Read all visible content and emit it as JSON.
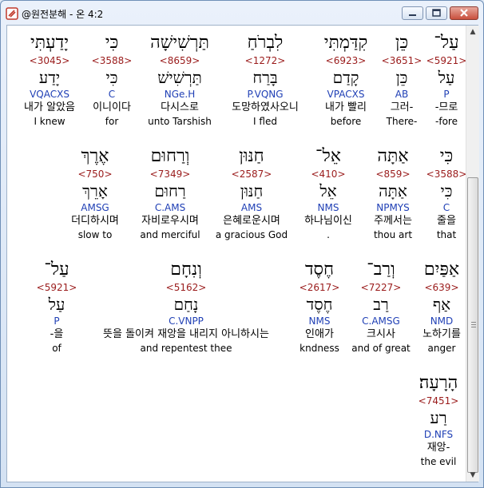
{
  "window": {
    "title": "@원전분해 - 온 4:2",
    "icon": "app-dictionary-icon"
  },
  "words": [
    {
      "heb": "עַל־",
      "strong": "<5921>",
      "lemma": "עַל",
      "morph": "P",
      "kor": "-므로",
      "eng": "-fore"
    },
    {
      "heb": "כֵּן",
      "strong": "<3651>",
      "lemma": "כֵּן",
      "morph": "AB",
      "kor": "그러-",
      "eng": "There-"
    },
    {
      "heb": "קִדַּמְתִּי",
      "strong": "<6923>",
      "lemma": "קָדַם",
      "morph": "VPACXS",
      "kor": "내가 빨리",
      "eng": "before"
    },
    {
      "heb": "לִבְרֹחַ",
      "strong": "<1272>",
      "lemma": "בָּרַח",
      "morph": "P.VQNG",
      "kor": "도망하였사오니",
      "eng": "I fled"
    },
    {
      "heb": "תַּרְשִׁישָׁה",
      "strong": "<8659>",
      "lemma": "תַּרְשִׁישׁ",
      "morph": "NGe.H",
      "kor": "다시스로",
      "eng": "unto Tarshish"
    },
    {
      "heb": "כִּי",
      "strong": "<3588>",
      "lemma": "כִּי",
      "morph": "C",
      "kor": "이니이다",
      "eng": "for"
    },
    {
      "heb": "יָדַעְתִּי",
      "strong": "<3045>",
      "lemma": "יָדַע",
      "morph": "VQACXS",
      "kor": "내가 알았음",
      "eng": "I knew"
    },
    {
      "heb": "כִּי",
      "strong": "<3588>",
      "lemma": "כִּי",
      "morph": "C",
      "kor": "줄을",
      "eng": "that"
    },
    {
      "heb": "אַתָּה",
      "strong": "<859>",
      "lemma": "אַתָּה",
      "morph": "NPMYS",
      "kor": "주께서는",
      "eng": "thou art"
    },
    {
      "heb": "אֵל־",
      "strong": "<410>",
      "lemma": "אֵל",
      "morph": "NMS",
      "kor": "하나님이신",
      "eng": "."
    },
    {
      "heb": "חַנּוּן",
      "strong": "<2587>",
      "lemma": "חַנּוּן",
      "morph": "AMS",
      "kor": "은혜로운시며",
      "eng": "a gracious God"
    },
    {
      "heb": "וְרַחוּם",
      "strong": "<7349>",
      "lemma": "רַחוּם",
      "morph": "C.AMS",
      "kor": "자비로우시며",
      "eng": "and merciful"
    },
    {
      "heb": "אֶרֶךְ",
      "strong": "<750>",
      "lemma": "אָרֵךְ",
      "morph": "AMSG",
      "kor": "더디하시며",
      "eng": "slow to"
    },
    {
      "heb": "אַפַּיִם",
      "strong": "<639>",
      "lemma": "אַף",
      "morph": "NMD",
      "kor": "노하기를",
      "eng": "anger"
    },
    {
      "heb": "וְרַב־",
      "strong": "<7227>",
      "lemma": "רַב",
      "morph": "C.AMSG",
      "kor": "크시사",
      "eng": "and of great"
    },
    {
      "heb": "חֶסֶד",
      "strong": "<2617>",
      "lemma": "חֶסֶד",
      "morph": "NMS",
      "kor": "인애가",
      "eng": "kndness"
    },
    {
      "heb": "וְנִחָם",
      "strong": "<5162>",
      "lemma": "נָחַם",
      "morph": "C.VNPP",
      "kor": "뜻을 돌이켜 재앙을 내리지 아니하시는",
      "eng": "and repentest thee"
    },
    {
      "heb": "עַל־",
      "strong": "<5921>",
      "lemma": "עַל",
      "morph": "P",
      "kor": "-을",
      "eng": "of"
    },
    {
      "heb": "הָרָעָה׃",
      "strong": "<7451>",
      "lemma": "רַע",
      "morph": "D.NFS",
      "kor": "재앙-",
      "eng": "the evil"
    }
  ]
}
